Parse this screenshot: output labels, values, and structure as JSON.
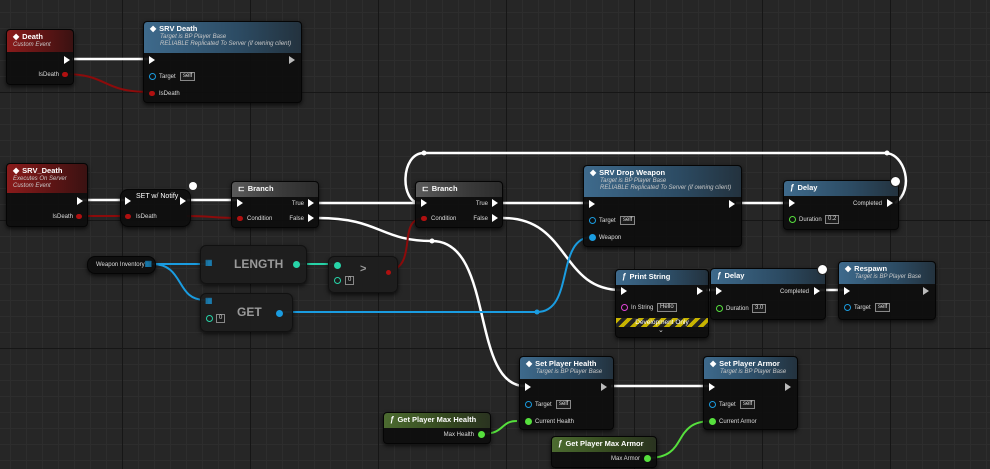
{
  "nodes": {
    "death_event": {
      "title": "Death",
      "subtitle": "Custom Event",
      "pin": "IsDeath"
    },
    "srv_death_call": {
      "title": "SRV Death",
      "subtitle1": "Target is BP Player Base",
      "subtitle2": "RELIABLE Replicated To Server (if owning client)",
      "target_label": "Target",
      "target_value": "self",
      "pin": "IsDeath"
    },
    "srv_death_event": {
      "title": "SRV_Death",
      "subtitle1": "Executes On Server",
      "subtitle2": "Custom Event",
      "pin": "IsDeath"
    },
    "set_notify": {
      "title": "SET w/ Notify",
      "pin": "IsDeath"
    },
    "branch1": {
      "title": "Branch",
      "condition": "Condition",
      "true_label": "True",
      "false_label": "False"
    },
    "branch2": {
      "title": "Branch",
      "condition": "Condition",
      "true_label": "True",
      "false_label": "False"
    },
    "weapon_inventory": {
      "label": "Weapon Inventory"
    },
    "length": {
      "label": "LENGTH"
    },
    "get": {
      "label": "GET",
      "index": "0"
    },
    "greater": {
      "symbol": ">",
      "value": "0"
    },
    "srv_drop_weapon": {
      "title": "SRV Drop Weapon",
      "subtitle1": "Target is BP Player Base",
      "subtitle2": "RELIABLE Replicated To Server (if owning client)",
      "target_label": "Target",
      "target_value": "self",
      "weapon_label": "Weapon"
    },
    "delay1": {
      "title": "Delay",
      "completed": "Completed",
      "duration_label": "Duration",
      "duration_value": "0.2"
    },
    "print_string": {
      "title": "Print String",
      "in_string_label": "In String",
      "in_string_value": "Hello",
      "dev_only": "Development Only"
    },
    "delay2": {
      "title": "Delay",
      "completed": "Completed",
      "duration_label": "Duration",
      "duration_value": "3.0"
    },
    "respawn": {
      "title": "Respawn",
      "subtitle": "Target is BP Player Base",
      "target_label": "Target",
      "target_value": "self"
    },
    "set_health": {
      "title": "Set Player Health",
      "subtitle": "Target is BP Player Base",
      "target_label": "Target",
      "target_value": "self",
      "pin": "Current Health"
    },
    "set_armor": {
      "title": "Set Player Armor",
      "subtitle": "Target is BP Player Base",
      "target_label": "Target",
      "target_value": "self",
      "pin": "Current Armor"
    },
    "max_health": {
      "title": "Get Player Max Health",
      "pin": "Max Health"
    },
    "max_armor": {
      "title": "Get Player Max Armor",
      "pin": "Max Armor"
    }
  },
  "colors": {
    "exec_wire": "#ffffff",
    "bool_wire": "#8c0b0b",
    "object_wire": "#1a9ce0",
    "int_wire": "#27d4a8",
    "float_wire": "#56e03d",
    "event_header": "#8a1b1b",
    "function_header": "#3e6a8c",
    "pure_header": "#4c6b30"
  }
}
